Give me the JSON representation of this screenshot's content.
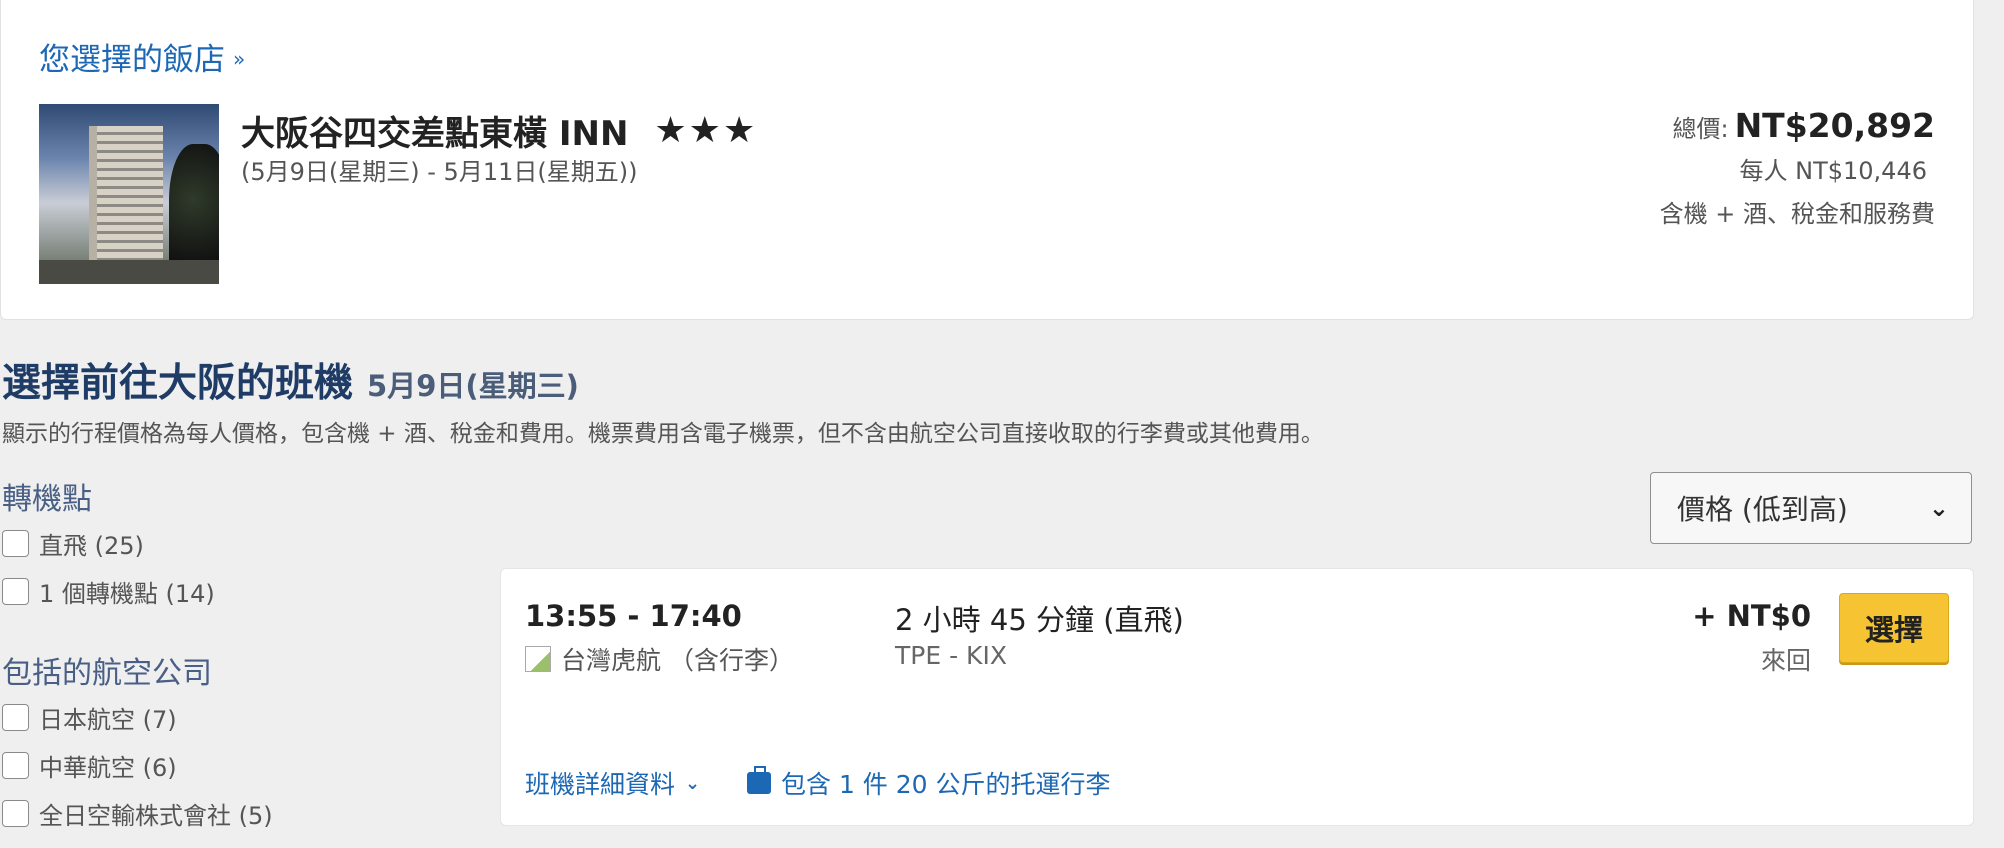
{
  "hotel": {
    "section_link": "您選擇的飯店",
    "name": "大阪谷四交差點東橫 INN",
    "stars": "★★★",
    "dates": "(5月9日(星期三) - 5月11日(星期五))",
    "total_label": "總價:",
    "total_value": "NT$20,892",
    "per_person": "每人 NT$10,446",
    "includes": "含機 + 酒、稅金和服務費"
  },
  "flights_section": {
    "title": "選擇前往大阪的班機",
    "date": "5月9日(星期三)",
    "note": "顯示的行程價格為每人價格，包含機 + 酒、稅金和費用。機票費用含電子機票，但不含由航空公司直接收取的行李費或其他費用。"
  },
  "filters": {
    "stops_heading": "轉機點",
    "stops": [
      {
        "label": "直飛 (25)"
      },
      {
        "label": "1 個轉機點 (14)"
      }
    ],
    "airlines_heading": "包括的航空公司",
    "airlines": [
      {
        "label": "日本航空 (7)"
      },
      {
        "label": "中華航空 (6)"
      },
      {
        "label": "全日空輸株式會社 (5)"
      }
    ]
  },
  "sort": {
    "selected": "價格 (低到高)"
  },
  "flight": {
    "time": "13:55 - 17:40",
    "airline": "台灣虎航 （含行李）",
    "duration": "2 小時 45 分鐘 (直飛)",
    "route": "TPE - KIX",
    "price": "+ NT$0",
    "price_sub": "來回",
    "select_label": "選擇",
    "details_link": "班機詳細資料",
    "baggage": "包含 1 件 20 公斤的托運行李"
  },
  "colors": {
    "link": "#1d68b4",
    "heading": "#1f3c66",
    "button": "#f6c332",
    "background": "#efefef"
  }
}
